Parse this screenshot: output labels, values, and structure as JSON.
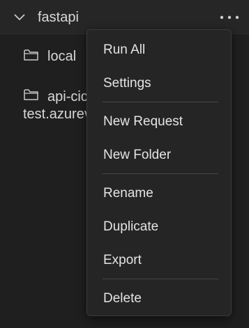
{
  "tree": {
    "folder_name": "fastapi",
    "items": [
      {
        "label": "local",
        "icon": "folder-icon"
      },
      {
        "label_line1": "api-cic",
        "label_line2": "test.azurev",
        "icon": "folder-icon"
      }
    ]
  },
  "context_menu": {
    "items": [
      {
        "label": "Run All"
      },
      {
        "label": "Settings"
      },
      {
        "label": "New Request"
      },
      {
        "label": "New Folder"
      },
      {
        "label": "Rename"
      },
      {
        "label": "Duplicate"
      },
      {
        "label": "Export"
      },
      {
        "label": "Delete"
      }
    ]
  }
}
